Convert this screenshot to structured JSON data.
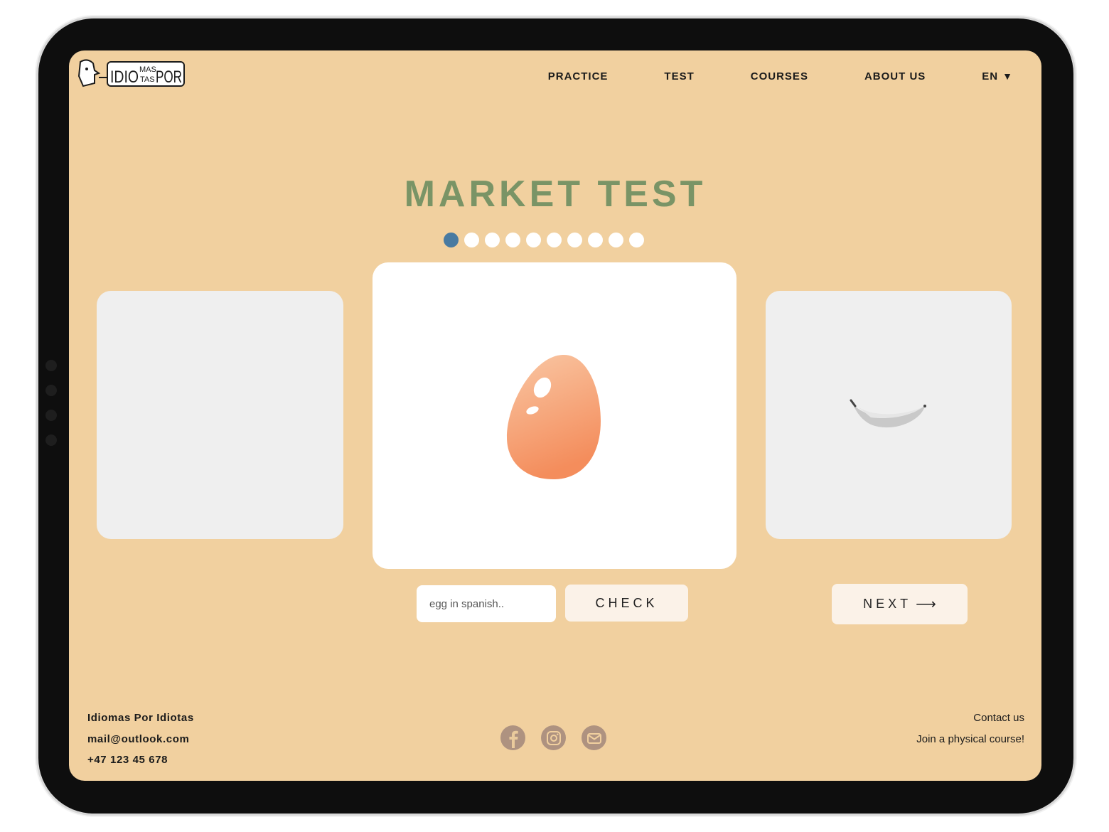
{
  "brand": {
    "logo_text_a": "IDIO",
    "logo_text_b": "MAS",
    "logo_text_c": "TAS",
    "logo_text_d": "POR"
  },
  "nav": {
    "items": [
      {
        "label": "PRACTICE"
      },
      {
        "label": "TEST"
      },
      {
        "label": "COURSES"
      },
      {
        "label": "ABOUT US"
      }
    ],
    "language": "EN",
    "language_caret": "▼"
  },
  "main": {
    "title": "MARKET TEST",
    "progress": {
      "total": 10,
      "current": 1
    },
    "input_placeholder": "egg in spanish..",
    "input_value": "",
    "check_label": "CHECK",
    "next_label": "NEXT",
    "next_arrow": "⟶",
    "current_item_icon": "egg-icon",
    "next_item_icon": "banana-icon"
  },
  "footer": {
    "company": "Idiomas Por Idiotas",
    "email": "mail@outlook.com",
    "phone": "+47 123 45 678",
    "contact": "Contact us",
    "join": "Join a physical course!",
    "socials": [
      "facebook-icon",
      "instagram-icon",
      "mail-icon"
    ]
  },
  "colors": {
    "background": "#f1d09f",
    "title": "#7a9466",
    "active_dot": "#487aa1",
    "social": "#ae9280"
  }
}
